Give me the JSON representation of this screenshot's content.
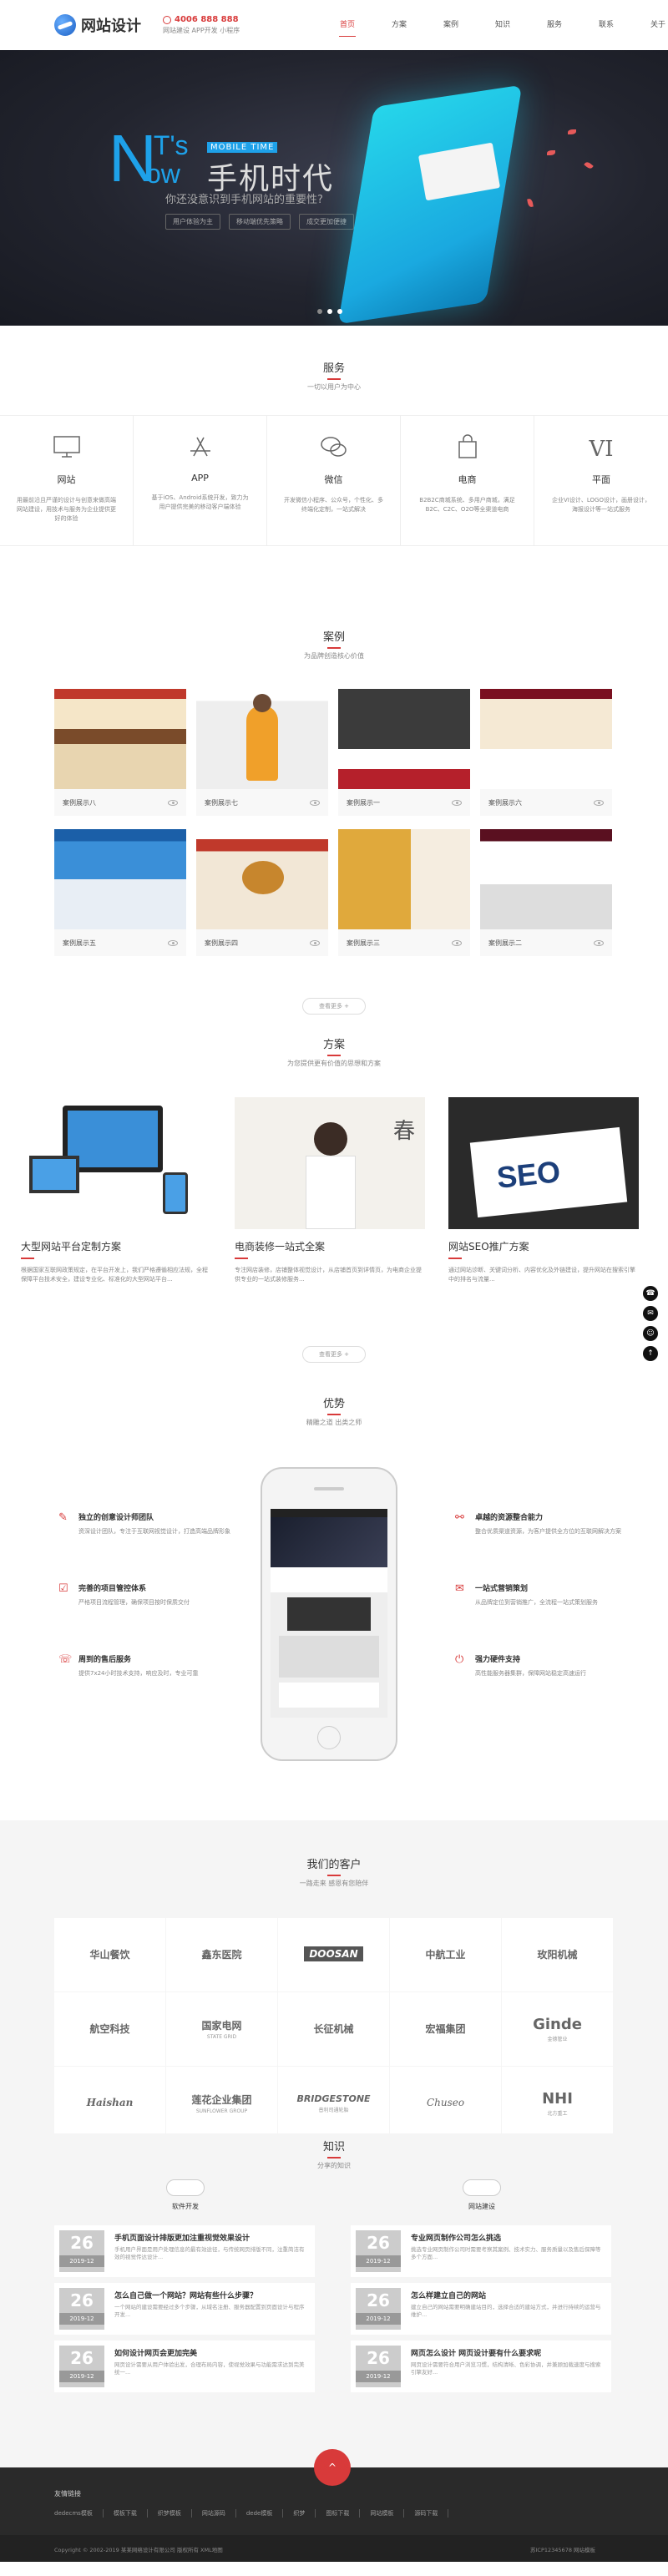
{
  "header": {
    "logo_text": "网站设计",
    "phone": "4006 888 888",
    "sub": "网站建设 APP开发 小程序",
    "nav": [
      "首页",
      "方案",
      "案例",
      "知识",
      "服务",
      "联系",
      "关于"
    ],
    "active_nav": 0
  },
  "banner": {
    "n": "N",
    "its": "IT's",
    "ow": "ow",
    "mobile_time": "MOBILE TIME",
    "cn_title": "手机时代",
    "tagline": "你还没意识到手机网站的重要性?",
    "tags": [
      "用户体验为主",
      "移动端优先策略",
      "成交更加便捷"
    ]
  },
  "services": {
    "title": "服务",
    "subtitle": "一切以用户为中心",
    "items": [
      {
        "name": "网站",
        "icon": "monitor-icon",
        "desc": "用最前沿且严谨的设计与创意来做高端网站建设，用技术与服务为企业提供更好的体验"
      },
      {
        "name": "APP",
        "icon": "app-store-icon",
        "desc": "基于iOS、Android系统开发，致力为用户提供完美的移动客户端体验"
      },
      {
        "name": "微信",
        "icon": "wechat-icon",
        "desc": "开发微信小程序、公众号，个性化、多终端化定制，一站式解决"
      },
      {
        "name": "电商",
        "icon": "shopping-bag-icon",
        "desc": "B2B2C商城系统、多用户商城，满足B2C、C2C、O2O等全渠道电商"
      },
      {
        "name": "平面",
        "icon": "vi-icon",
        "desc": "企业VI设计、LOGO设计，画册设计，海报设计等一站式服务"
      }
    ]
  },
  "cases": {
    "title": "案例",
    "subtitle": "为品牌创造核心价值",
    "items": [
      {
        "name": "案例展示八"
      },
      {
        "name": "案例展示七"
      },
      {
        "name": "案例展示一"
      },
      {
        "name": "案例展示六"
      },
      {
        "name": "案例展示五"
      },
      {
        "name": "案例展示四"
      },
      {
        "name": "案例展示三"
      },
      {
        "name": "案例展示二"
      }
    ],
    "more": "查看更多 +"
  },
  "solutions": {
    "title": "方案",
    "subtitle": "为您提供更有价值的思想和方案",
    "items": [
      {
        "title": "大型网站平台定制方案",
        "desc": "根据国家互联网政策规定，在平台开发上，我们严格遵循相应法规，全程保障平台技术安全，建设专业化、标准化的大型网站平台..."
      },
      {
        "title": "电商装修一站式全案",
        "desc": "专注网店装修，店铺整体视觉设计，从店铺首页到详情页，为电商企业提供专业的一站式装修服务..."
      },
      {
        "title": "网站SEO推广方案",
        "desc": "通过网站诊断、关键词分析、内容优化及外链建设，提升网站在搜索引擎中的排名与流量..."
      }
    ],
    "more": "查看更多 +"
  },
  "advantage": {
    "title": "优势",
    "subtitle": "精雕之道 出类之师",
    "left": [
      {
        "title": "独立的创意设计师团队",
        "desc": "资深设计团队，专注于互联网视觉设计，打造高端品牌形象"
      },
      {
        "title": "完善的项目管控体系",
        "desc": "严格项目流程管理，确保项目按时保质交付"
      },
      {
        "title": "周到的售后服务",
        "desc": "提供7x24小时技术支持，响应及时，专业可靠"
      }
    ],
    "right": [
      {
        "title": "卓越的资源整合能力",
        "desc": "整合优质渠道资源，为客户提供全方位的互联网解决方案"
      },
      {
        "title": "一站式营销策划",
        "desc": "从品牌定位到营销推广，全流程一站式策划服务"
      },
      {
        "title": "强力硬件支持",
        "desc": "高性能服务器集群，保障网站稳定高速运行"
      }
    ]
  },
  "clients": {
    "title": "我们的客户",
    "subtitle": "一路走来 感恩有您陪伴",
    "logos": [
      {
        "name": "华山餐饮",
        "sub": ""
      },
      {
        "name": "鑫东医院",
        "sub": ""
      },
      {
        "name": "DOOSAN",
        "sub": ""
      },
      {
        "name": "中航工业",
        "sub": ""
      },
      {
        "name": "玫阳机械",
        "sub": ""
      },
      {
        "name": "航空科技",
        "sub": ""
      },
      {
        "name": "国家电网",
        "sub": "STATE GRID"
      },
      {
        "name": "长征机械",
        "sub": ""
      },
      {
        "name": "宏福集团",
        "sub": ""
      },
      {
        "name": "Ginde",
        "sub": "金德管业"
      },
      {
        "name": "Haishan",
        "sub": ""
      },
      {
        "name": "莲花企业集团",
        "sub": "SUNFLOWER GROUP"
      },
      {
        "name": "BRIDGESTONE",
        "sub": "普利司通轮胎"
      },
      {
        "name": "Chuseo",
        "sub": ""
      },
      {
        "name": "NHI",
        "sub": "北方重工"
      }
    ]
  },
  "knowledge": {
    "title": "知识",
    "subtitle": "分享的知识",
    "categories": [
      "软件开发",
      "网站建设"
    ],
    "left": [
      {
        "day": "26",
        "ym": "2019-12",
        "title": "手机页面设计排版更加注重视觉效果设计",
        "desc": "手机用户界面是用户处理信息的最有效途径，与传统网页排版不同，注重简洁有效的视觉传达设计..."
      },
      {
        "day": "26",
        "ym": "2019-12",
        "title": "怎么自己做一个网站？网站有些什么步骤？",
        "desc": "一个网站的建设需要经过多个步骤，从域名注册、服务器配置到页面设计与程序开发..."
      },
      {
        "day": "26",
        "ym": "2019-12",
        "title": "如何设计网页会更加完美",
        "desc": "网页设计需要从用户体验出发，合理布局内容，使视觉效果与功能需求达到完美统一..."
      }
    ],
    "right": [
      {
        "day": "26",
        "ym": "2019-12",
        "title": "专业网页制作公司怎么挑选",
        "desc": "挑选专业网页制作公司时需要考察其案例、技术实力、服务质量以及售后保障等多个方面..."
      },
      {
        "day": "26",
        "ym": "2019-12",
        "title": "怎么样建立自己的网站",
        "desc": "建立自己的网站需要明确建站目的，选择合适的建站方式，并进行持续的运营与维护..."
      },
      {
        "day": "26",
        "ym": "2019-12",
        "title": "网页怎么设计 网页设计要有什么要求呢",
        "desc": "网页设计需要符合用户浏览习惯，结构清晰、色彩协调，并兼顾加载速度与搜索引擎友好..."
      }
    ]
  },
  "footer": {
    "links_label": "友情链接",
    "links": [
      "dedecms模板",
      "模板下载",
      "织梦模板",
      "网站源码",
      "dede模板",
      "织梦",
      "图标下载",
      "网站模板",
      "源码下载"
    ],
    "copyright": "Copyright © 2002-2019 某某网络设计有限公司 版权所有  XML地图",
    "icp": "苏ICP12345678  网站模板",
    "top": "^"
  },
  "float": [
    "phone",
    "wechat",
    "qq",
    "top"
  ],
  "colors": {
    "accent": "#d83a3a",
    "banner_blue": "#1ea1e9"
  }
}
